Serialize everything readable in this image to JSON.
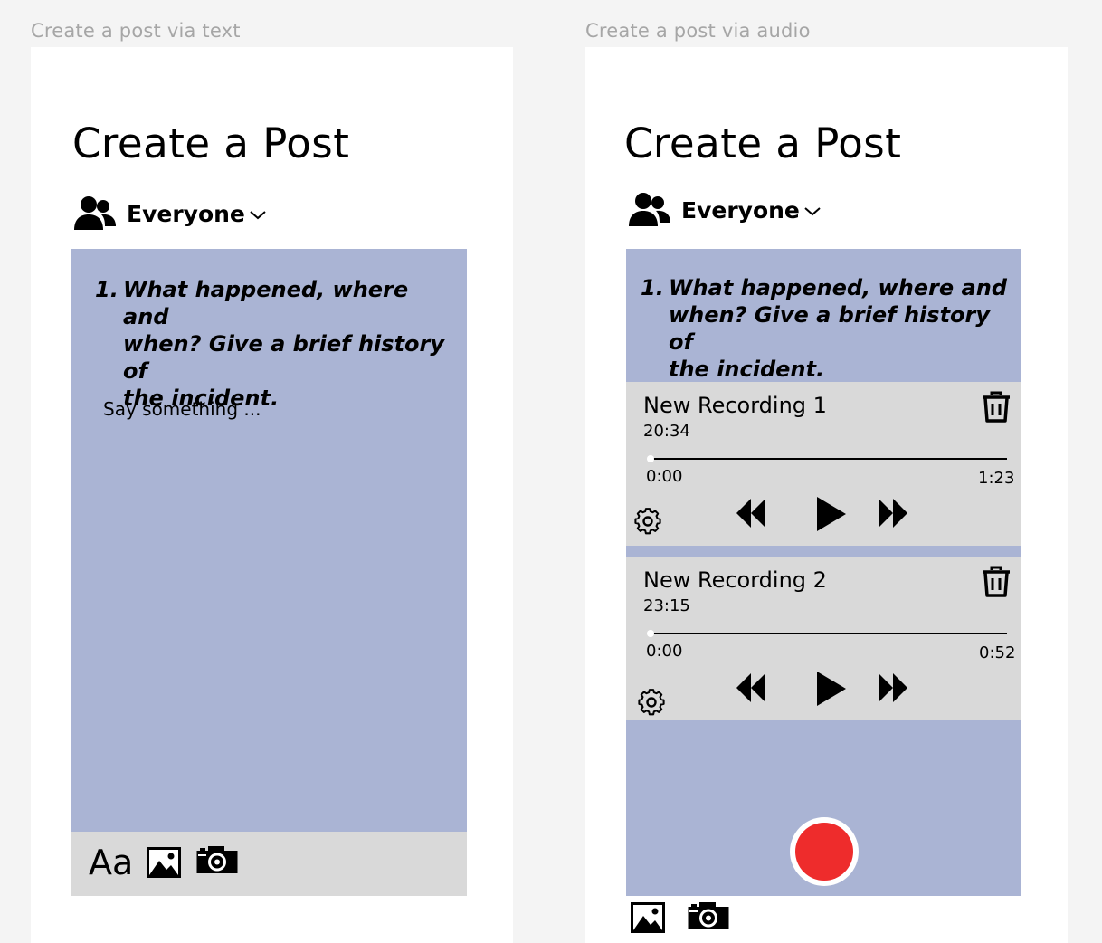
{
  "frames": {
    "text": {
      "label": "Create a post via text",
      "title": "Create a Post",
      "audience": "Everyone",
      "question": {
        "number": "1.",
        "lines": [
          "What happened, where and",
          "when? Give a brief history of",
          "the incident."
        ]
      },
      "input_placeholder": "Say something ...",
      "toolbar": {
        "text_format_label": "Aa",
        "icons": [
          "image-icon",
          "camera-icon"
        ]
      }
    },
    "audio": {
      "label": "Create a post via audio",
      "title": "Create a Post",
      "audience": "Everyone",
      "question": {
        "number": "1.",
        "lines": [
          "What happened, where and",
          "when? Give a brief history of",
          "the incident."
        ]
      },
      "recordings": [
        {
          "title": "New Recording 1",
          "date": "20:34",
          "position": "0:00",
          "duration": "1:23",
          "progress": 0
        },
        {
          "title": "New Recording 2",
          "date": "23:15",
          "position": "0:00",
          "duration": "0:52",
          "progress": 0
        }
      ],
      "toolbar": {
        "icons": [
          "image-icon",
          "camera-icon"
        ]
      }
    }
  },
  "colors": {
    "background": "#f4f4f4",
    "frame": "#ffffff",
    "card": "#aab4d4",
    "panel": "#d9d9d9",
    "record": "#ee2c2c",
    "label": "#a6a6a6"
  }
}
